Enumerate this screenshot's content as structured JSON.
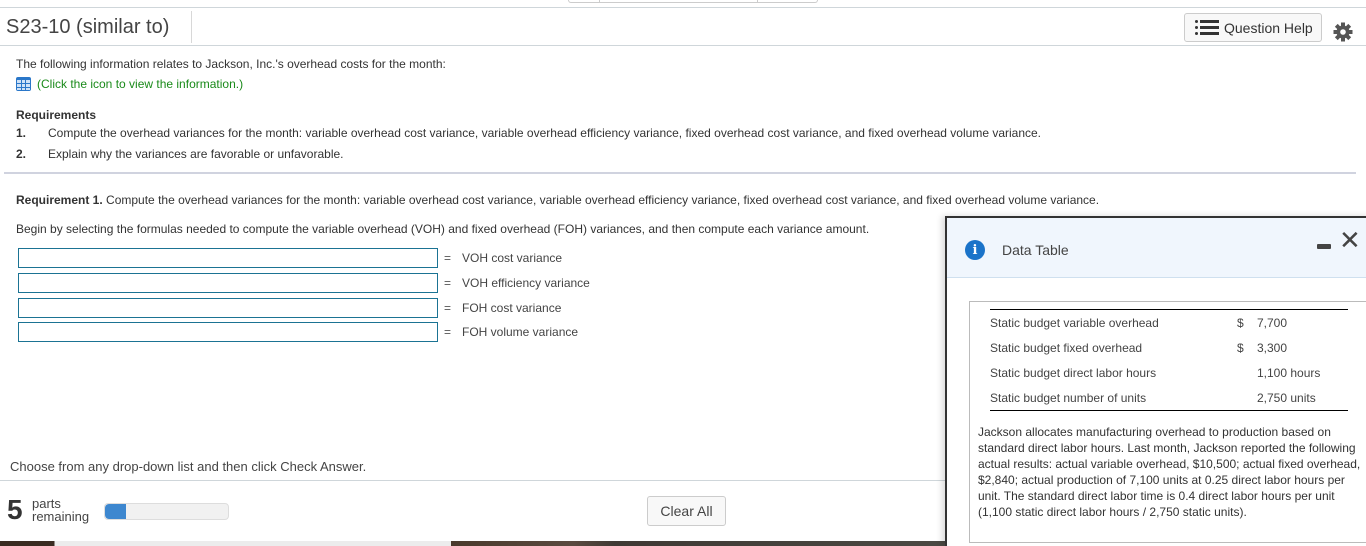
{
  "header": {
    "title": "S23-10 (similar to)",
    "help_button": "Question Help",
    "settings_icon": "gear-icon"
  },
  "problem": {
    "intro": "The following information relates to Jackson, Inc.'s overhead costs for the month:",
    "info_link": "(Click the icon to view the information.)",
    "requirements_title": "Requirements",
    "requirements": [
      {
        "num": "1.",
        "text": "Compute the overhead variances for the month: variable overhead cost variance, variable overhead efficiency variance, fixed overhead cost variance, and fixed overhead volume variance."
      },
      {
        "num": "2.",
        "text": "Explain why the variances are favorable or unfavorable."
      }
    ]
  },
  "requirement1": {
    "bold": "Requirement 1.",
    "text": " Compute the overhead variances for the month: variable overhead cost variance, variable overhead efficiency variance, fixed overhead cost variance, and fixed overhead volume variance.",
    "instruction": "Begin by selecting the formulas needed to compute the variable overhead (VOH) and fixed overhead (FOH) variances, and then compute each variance amount.",
    "formulas": [
      {
        "value": "",
        "equals": "=",
        "label": "VOH cost variance"
      },
      {
        "value": "",
        "equals": "=",
        "label": "VOH efficiency variance"
      },
      {
        "value": "",
        "equals": "=",
        "label": "FOH cost variance"
      },
      {
        "value": "",
        "equals": "=",
        "label": "FOH volume variance"
      }
    ]
  },
  "footer": {
    "instruction": "Choose from any drop-down list and then click Check Answer.",
    "parts_count": "5",
    "parts_label_1": "parts",
    "parts_label_2": "remaining",
    "progress_fraction": 0.17,
    "clear_button": "Clear All"
  },
  "dialog": {
    "title": "Data Table",
    "rows": [
      {
        "label": "Static budget variable overhead",
        "currency": "$",
        "value": "7,700"
      },
      {
        "label": "Static budget fixed overhead",
        "currency": "$",
        "value": "3,300"
      },
      {
        "label": "Static budget direct labor hours",
        "currency": "",
        "value": "1,100 hours"
      },
      {
        "label": "Static budget number of units",
        "currency": "",
        "value": "2,750 units"
      }
    ],
    "paragraph": "Jackson allocates manufacturing overhead to production based on standard direct labor hours. Last month, Jackson reported the following actual results: actual variable overhead, $10,500; actual fixed overhead, $2,840; actual production of 7,100 units at 0.25 direct labor hours per unit. The standard direct labor time is 0.4 direct labor hours per unit (1,100 static direct labor hours / 2,750 static units)."
  },
  "colors": {
    "link_green": "#1a8a1a",
    "input_border": "#1b7393",
    "progress_blue": "#3d87cf",
    "info_blue": "#1a73c9"
  }
}
